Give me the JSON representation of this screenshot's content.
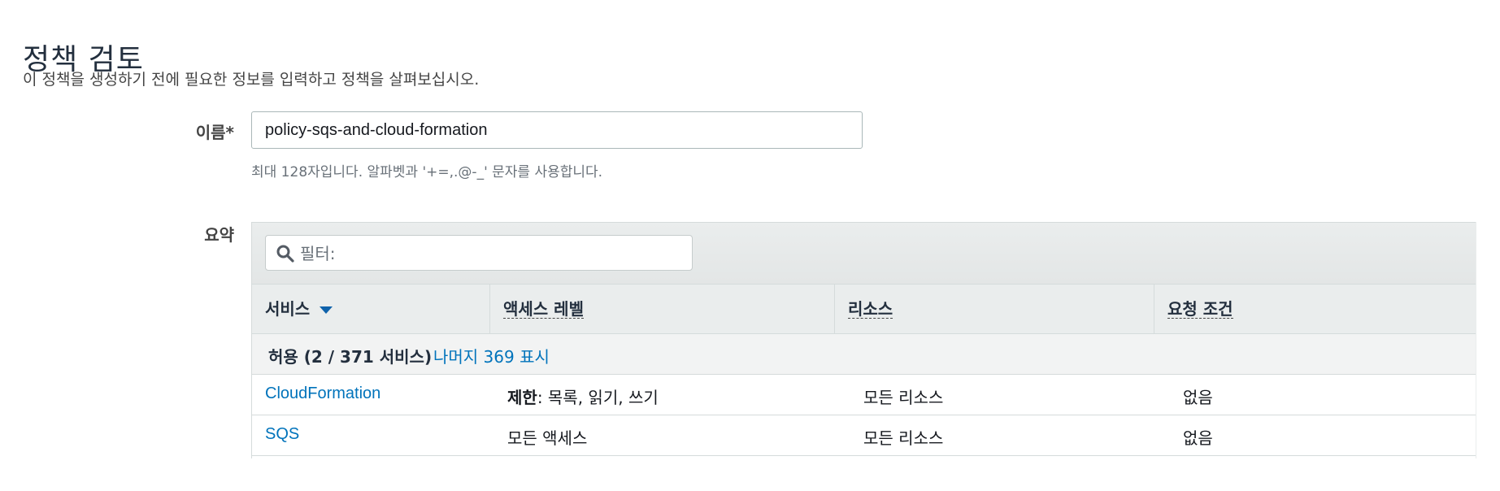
{
  "page": {
    "title": "정책 검토",
    "description": "이 정책을 생성하기 전에 필요한 정보를 입력하고 정책을 살펴보십시오."
  },
  "name_field": {
    "label": "이름*",
    "value": "policy-sqs-and-cloud-formation",
    "hint": "최대 128자입니다. 알파벳과 '+=,.@-_' 문자를 사용합니다."
  },
  "summary": {
    "label": "요약",
    "filter_placeholder": "필터:",
    "columns": [
      "서비스",
      "액세스 레벨",
      "리소스",
      "요청 조건"
    ],
    "group": {
      "title": "허용 (2 / 371 서비스)",
      "show_more_link": "나머지 369 표시"
    },
    "rows": [
      {
        "service": "CloudFormation",
        "access_prefix": "제한",
        "access_rest": ": 목록, 읽기, 쓰기",
        "resource": "모든 리소스",
        "condition": "없음"
      },
      {
        "service": "SQS",
        "access_prefix": "",
        "access_rest": "모든 액세스",
        "resource": "모든 리소스",
        "condition": "없음"
      }
    ]
  },
  "colors": {
    "link": "#0073bb",
    "header_bg": "#eaeded",
    "border": "#d5dbdb"
  },
  "icons": {
    "filter": "search-icon",
    "sort": "caret-down-icon"
  }
}
